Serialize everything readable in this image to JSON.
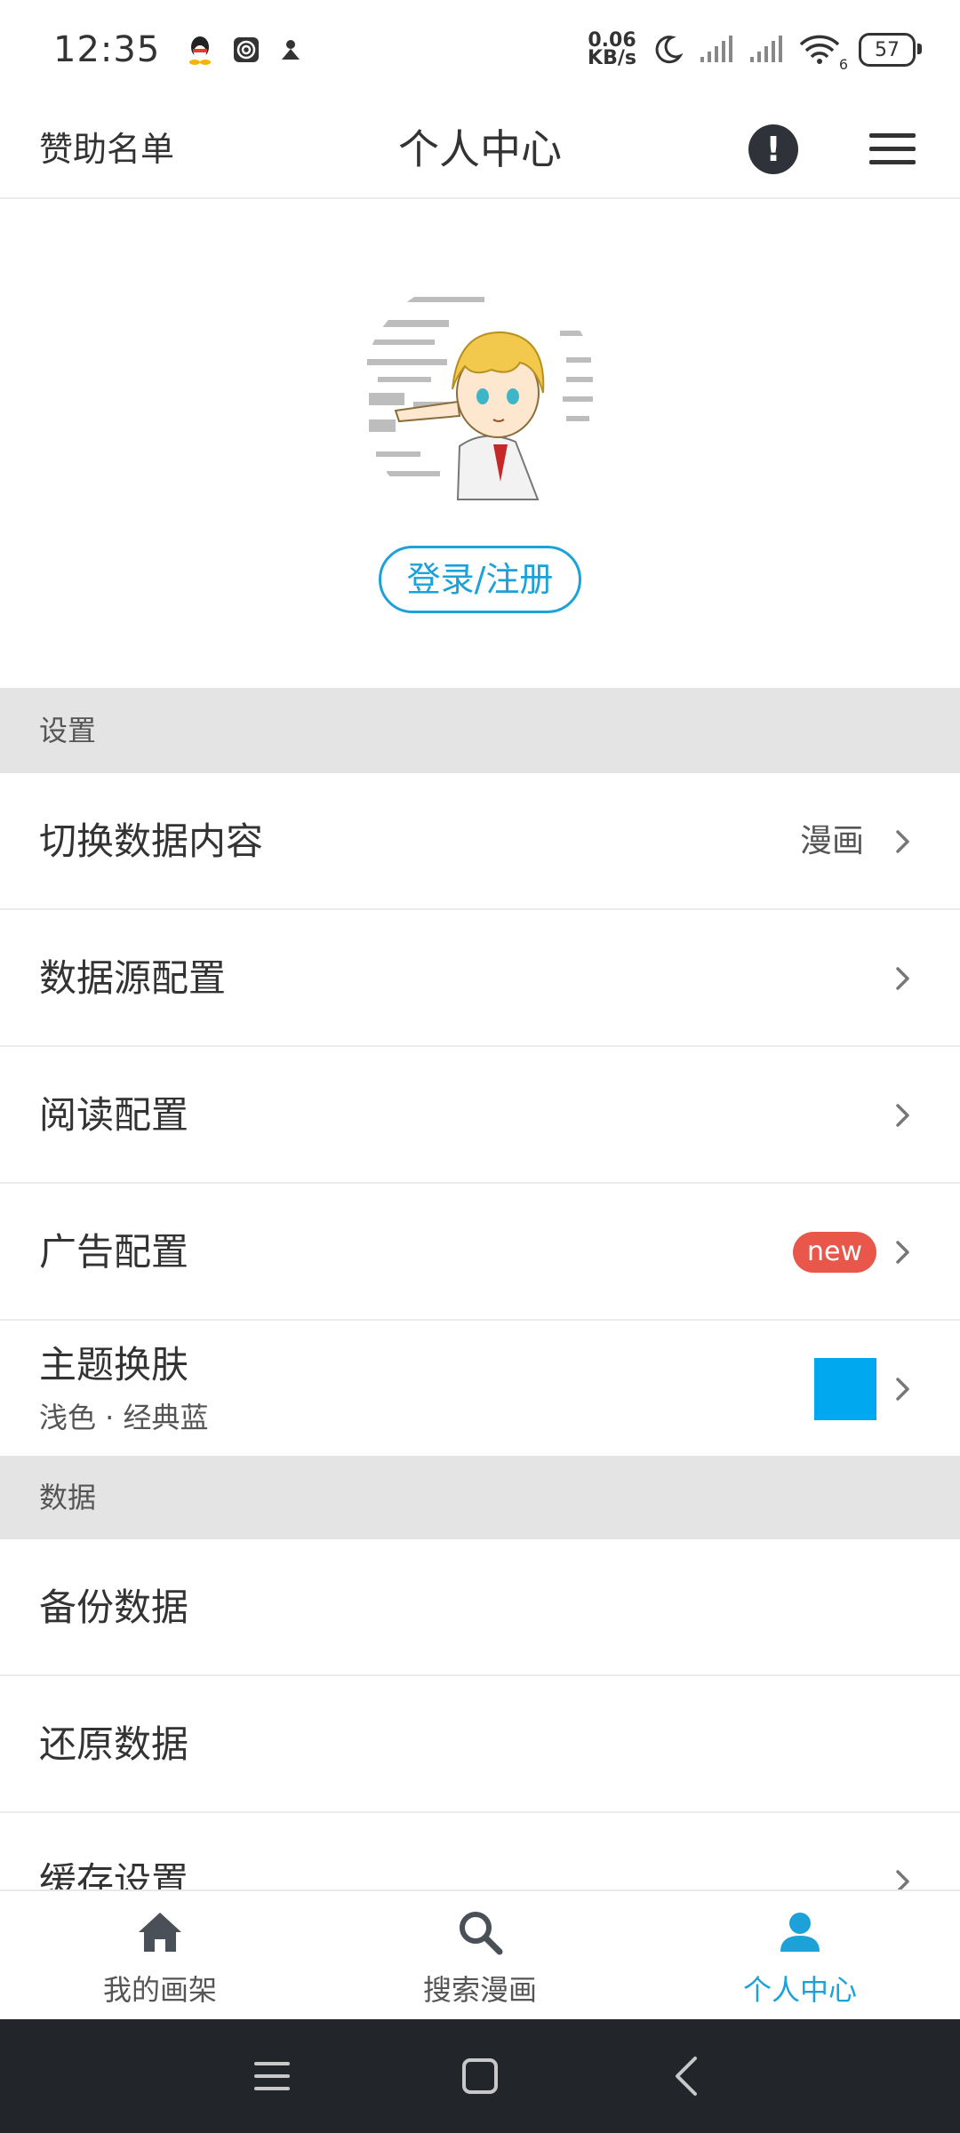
{
  "status_bar": {
    "time": "12:35",
    "net_speed_value": "0.06",
    "net_speed_unit": "KB/s",
    "wifi_badge": "6",
    "battery": "57",
    "icons": [
      "qq-icon",
      "spiral-app-icon",
      "person-app-icon",
      "moon-icon",
      "signal-icon",
      "signal-icon",
      "wifi-icon",
      "battery-icon"
    ]
  },
  "header": {
    "left_link": "赞助名单",
    "title": "个人中心",
    "info_symbol": "!"
  },
  "profile": {
    "login_button": "登录/注册"
  },
  "sections": {
    "settings": {
      "title": "设置",
      "items": [
        {
          "label": "切换数据内容",
          "value": "漫画"
        },
        {
          "label": "数据源配置"
        },
        {
          "label": "阅读配置"
        },
        {
          "label": "广告配置",
          "badge": "new"
        },
        {
          "label": "主题换肤",
          "sub": "浅色 · 经典蓝",
          "swatch_color": "#00a8ef"
        }
      ]
    },
    "data": {
      "title": "数据",
      "items": [
        {
          "label": "备份数据"
        },
        {
          "label": "还原数据"
        },
        {
          "label": "缓存设置"
        }
      ]
    }
  },
  "bottom_nav": {
    "tabs": [
      {
        "label": "我的画架",
        "icon": "home-icon"
      },
      {
        "label": "搜索漫画",
        "icon": "search-icon"
      },
      {
        "label": "个人中心",
        "icon": "person-icon",
        "active": true
      }
    ]
  },
  "colors": {
    "accent": "#1da1d9",
    "badge": "#e8574a",
    "section_bg": "#e4e4e4",
    "system_nav_bg": "#22262b"
  }
}
